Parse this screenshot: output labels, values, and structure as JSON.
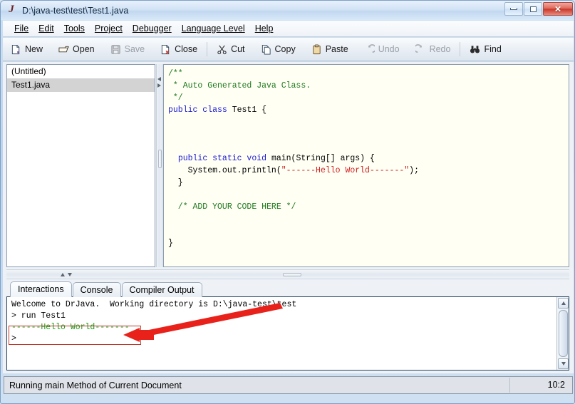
{
  "window": {
    "title": "D:\\java-test\\test\\Test1.java",
    "app_icon": "drjava-j-icon",
    "controls": {
      "minimize": "minimize-icon",
      "maximize": "maximize-icon",
      "close": "✕"
    }
  },
  "menubar": {
    "items": [
      {
        "label": "File"
      },
      {
        "label": "Edit"
      },
      {
        "label": "Tools"
      },
      {
        "label": "Project"
      },
      {
        "label": "Debugger"
      },
      {
        "label": "Language Level"
      },
      {
        "label": "Help"
      }
    ]
  },
  "toolbar": {
    "buttons": [
      {
        "label": "New",
        "icon": "new-file-icon",
        "enabled": true
      },
      {
        "label": "Open",
        "icon": "open-folder-icon",
        "enabled": true
      },
      {
        "label": "Save",
        "icon": "save-disk-icon",
        "enabled": false
      },
      {
        "label": "Close",
        "icon": "close-file-icon",
        "enabled": true
      },
      {
        "label": "Cut",
        "icon": "scissors-icon",
        "enabled": true
      },
      {
        "label": "Copy",
        "icon": "copy-icon",
        "enabled": true
      },
      {
        "label": "Paste",
        "icon": "clipboard-icon",
        "enabled": true
      },
      {
        "label": "Undo",
        "icon": "undo-arrow-icon",
        "enabled": false
      },
      {
        "label": "Redo",
        "icon": "redo-arrow-icon",
        "enabled": false
      },
      {
        "label": "Find",
        "icon": "binoculars-icon",
        "enabled": true
      }
    ]
  },
  "file_list": {
    "items": [
      {
        "name": "(Untitled)",
        "selected": false
      },
      {
        "name": "Test1.java",
        "selected": true
      }
    ]
  },
  "editor": {
    "background_color": "#fffff4",
    "lines": [
      {
        "segments": [
          {
            "text": "/**",
            "style": "cmt"
          }
        ]
      },
      {
        "segments": [
          {
            "text": " * Auto Generated Java Class.",
            "style": "cmt"
          }
        ]
      },
      {
        "segments": [
          {
            "text": " */",
            "style": "cmt"
          }
        ]
      },
      {
        "segments": [
          {
            "text": "public class",
            "style": "kw"
          },
          {
            "text": " Test1 {",
            "style": "plain"
          }
        ]
      },
      {
        "segments": []
      },
      {
        "segments": []
      },
      {
        "segments": []
      },
      {
        "segments": [
          {
            "text": "  ",
            "style": "plain"
          },
          {
            "text": "public static void",
            "style": "kw"
          },
          {
            "text": " main(String[] args) {",
            "style": "plain"
          }
        ]
      },
      {
        "segments": [
          {
            "text": "    System.out.println(",
            "style": "plain"
          },
          {
            "text": "\"------Hello World-------\"",
            "style": "str"
          },
          {
            "text": ");",
            "style": "plain"
          }
        ]
      },
      {
        "segments": [
          {
            "text": "  }",
            "style": "plain"
          }
        ]
      },
      {
        "segments": []
      },
      {
        "segments": [
          {
            "text": "  /* ADD YOUR CODE HERE */",
            "style": "cmt"
          }
        ]
      },
      {
        "segments": []
      },
      {
        "segments": []
      },
      {
        "segments": [
          {
            "text": "}",
            "style": "plain"
          }
        ]
      }
    ]
  },
  "bottom_tabs": [
    {
      "label": "Interactions",
      "active": true
    },
    {
      "label": "Console",
      "active": false
    },
    {
      "label": "Compiler Output",
      "active": false
    }
  ],
  "interactions": {
    "lines": [
      {
        "segments": [
          {
            "text": "Welcome to DrJava.  Working directory is D:\\java-test\\test",
            "style": "plain"
          }
        ]
      },
      {
        "segments": [
          {
            "text": "> run Test1",
            "style": "plain"
          }
        ]
      },
      {
        "segments": [
          {
            "text": "------Hello World-------",
            "style": "out-green"
          }
        ]
      },
      {
        "segments": [
          {
            "text": ">",
            "style": "plain"
          }
        ]
      }
    ]
  },
  "statusbar": {
    "message": "Running main Method of Current Document",
    "position": "10:2"
  },
  "annotation": {
    "highlight_color": "#c0392b",
    "arrow_color": "#e8221a",
    "target_text": "------Hello World-------"
  }
}
